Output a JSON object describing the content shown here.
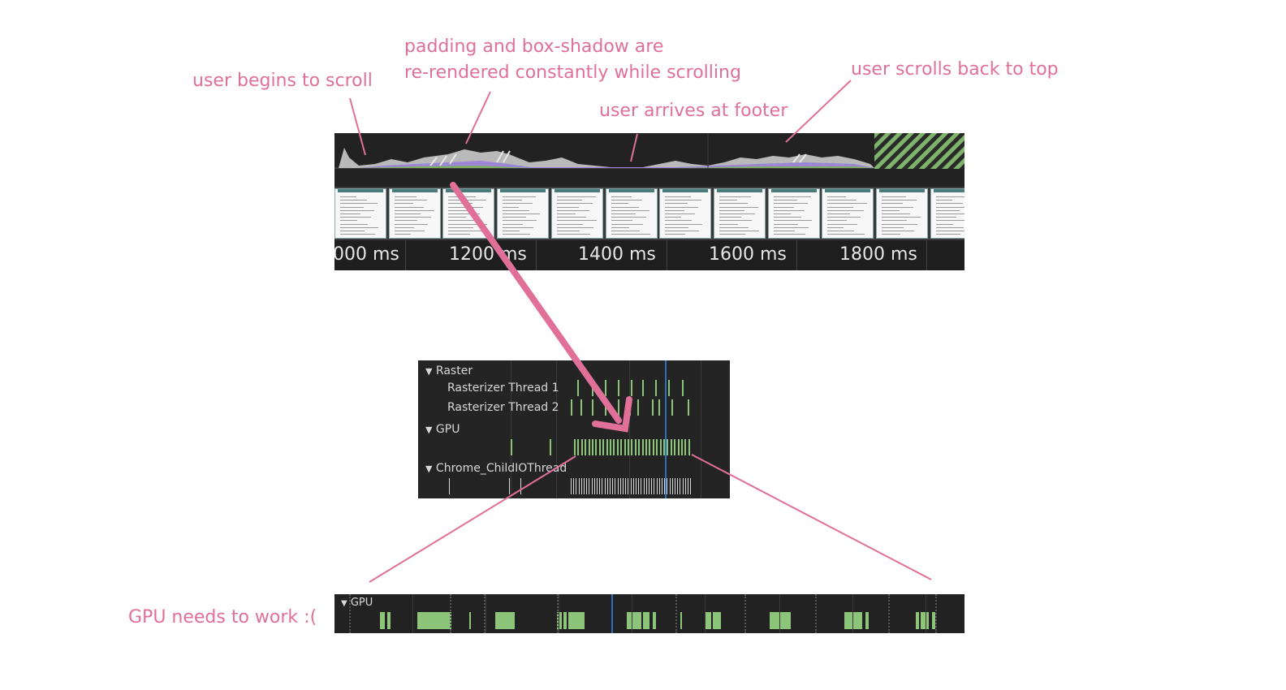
{
  "annotations": {
    "begins_scroll": "user begins to scroll",
    "padding_line1": "padding and box-shadow are",
    "padding_line2": "re-rendered constantly while scrolling",
    "arrives_footer": "user arrives at footer",
    "scrolls_back": "user scrolls back to top",
    "gpu_needs_work": "GPU needs to work :("
  },
  "timeline": {
    "tick_labels": [
      "000 ms",
      "1200 ms",
      "1400 ms",
      "1600 ms",
      "1800 ms"
    ],
    "filmstrip_frame_count": 12
  },
  "threads": {
    "raster_group": "Raster",
    "rasterizer_1": "Rasterizer Thread 1",
    "rasterizer_2": "Rasterizer Thread 2",
    "gpu_group": "GPU",
    "childio_group": "Chrome_ChildIOThread"
  },
  "gpu_zoom": {
    "label": "GPU"
  },
  "colors": {
    "annotation_pink": "#e0709a",
    "panel_bg": "#222222",
    "task_green": "#8cc47a",
    "marker_blue": "#2f6fb5"
  }
}
